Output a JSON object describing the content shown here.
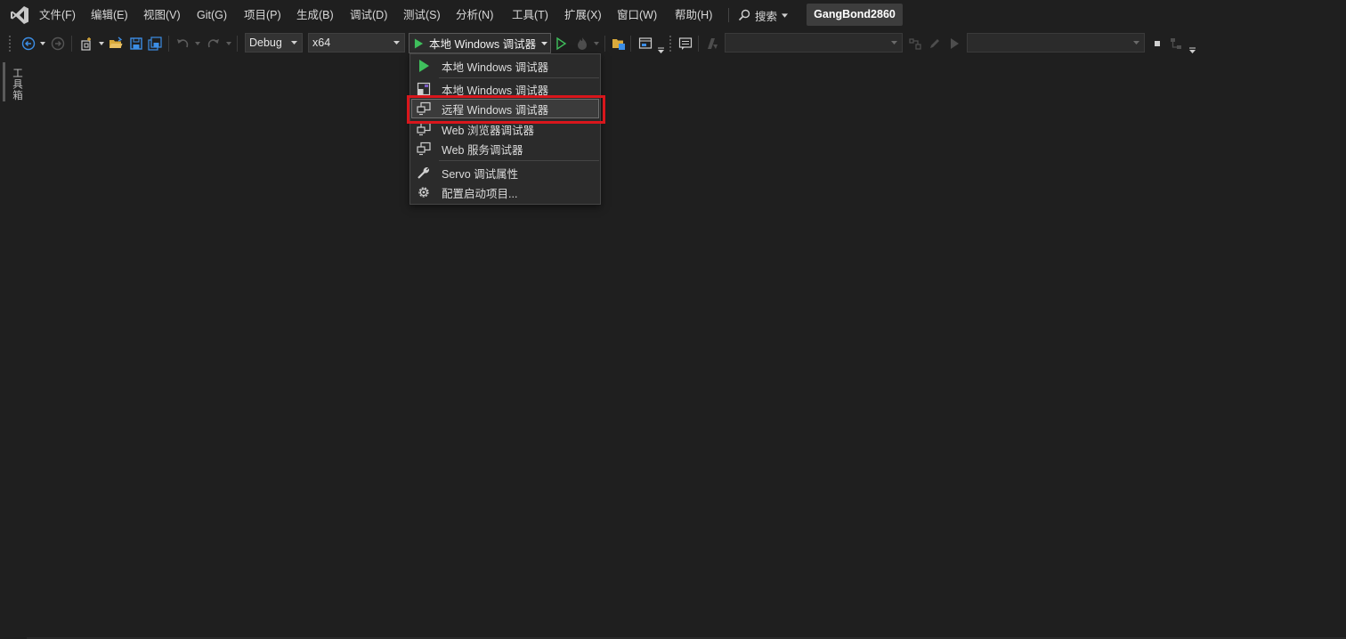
{
  "menubar": {
    "items": [
      "文件(F)",
      "编辑(E)",
      "视图(V)",
      "Git(G)",
      "项目(P)",
      "生成(B)",
      "调试(D)",
      "测试(S)",
      "分析(N)",
      "工具(T)",
      "扩展(X)",
      "窗口(W)",
      "帮助(H)"
    ],
    "search_label": "搜索",
    "project_name": "GangBond2860"
  },
  "toolbar": {
    "configuration": "Debug",
    "platform": "x64",
    "start_target": "本地 Windows 调试器"
  },
  "toolbox": {
    "label": "工具箱"
  },
  "dropdown": {
    "items": [
      {
        "label": "本地 Windows 调试器",
        "icon": "play-icon"
      },
      {
        "label": "本地 Windows 调试器",
        "icon": "local-debugger-icon"
      },
      {
        "label": "远程 Windows 调试器",
        "icon": "remote-debugger-icon",
        "highlighted": true
      },
      {
        "label": "Web 浏览器调试器",
        "icon": "web-browser-debugger-icon"
      },
      {
        "label": "Web 服务调试器",
        "icon": "web-service-debugger-icon"
      },
      {
        "label": "Servo 调试属性",
        "icon": "wrench-icon"
      },
      {
        "label": "配置启动项目...",
        "icon": "gear-icon"
      }
    ]
  },
  "colors": {
    "background": "#1f1f1f",
    "play_green": "#3fbf5c",
    "accent_blue": "#3c8ee6",
    "highlight_red": "#d9161c",
    "folder_yellow": "#d8a93b"
  }
}
